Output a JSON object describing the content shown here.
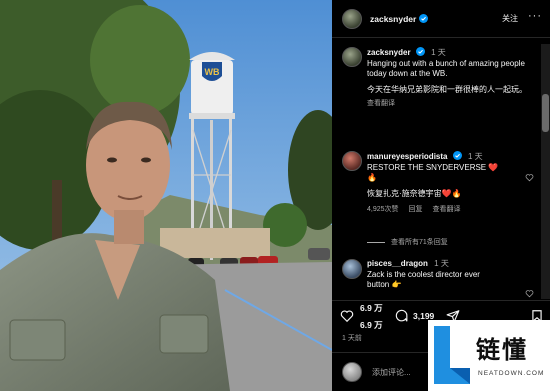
{
  "photo": {
    "water_tower_logo": "WB"
  },
  "header": {
    "username": "zacksnyder",
    "follow_label": "关注",
    "more_icon": "more-horizontal-icon"
  },
  "caption": {
    "username": "zacksnyder",
    "time": "1 天",
    "text_en": "Hanging out with a bunch of amazing people today down at the WB.",
    "text_zh": "今天在华纳兄弟影院和一群很棒的人一起玩。",
    "translate_label": "查看翻译"
  },
  "comments": [
    {
      "username": "manureyesperiodista",
      "time": "1 天",
      "text": "RESTORE THE SNYDERVERSE ❤️\n🔥",
      "text_zh": "恢复扎克·施奈德宇宙❤️🔥",
      "likes": "4,925次赞",
      "reply_label": "回复",
      "translate_label": "查看翻译",
      "view_replies": "查看所有71条回复"
    },
    {
      "username": "pisces__dragon",
      "time": "1 天",
      "text": "Zack is the coolest director ever\nbutton 👉"
    }
  ],
  "actions": {
    "likes_count": "6.9 万",
    "likes_count_2": "6.9 万",
    "comments_count": "3,199",
    "days_ago": "1 天前"
  },
  "add_comment": {
    "placeholder": "添加评论..."
  },
  "watermark": {
    "brand_cn": "链懂",
    "domain": "NEATDOWN.COM"
  },
  "colors": {
    "verified": "#0095f6",
    "like_red": "#ed4956",
    "panel_bg": "#000000"
  }
}
